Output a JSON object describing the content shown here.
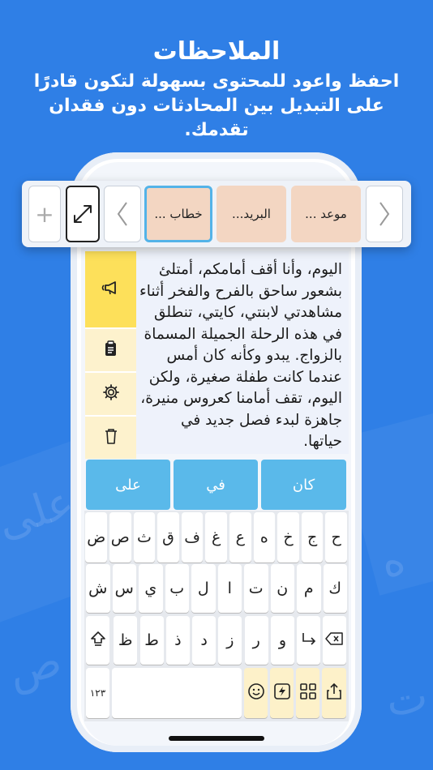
{
  "headline": {
    "title": "الملاحظات",
    "subtitle": "احفظ واعود للمحتوى بسهولة لتكون قادرًا على التبديل بين المحادثات دون فقدان تقدمك."
  },
  "background_letters": [
    "على",
    "ه",
    "ص",
    "ت"
  ],
  "tabbar": {
    "add_label": "+",
    "tabs": [
      {
        "label": "خطاب ...",
        "active": true
      },
      {
        "label": "البريد...",
        "active": false
      },
      {
        "label": "موعد ...",
        "active": false
      }
    ]
  },
  "note": {
    "text": "اليوم، وأنا أقف أمامكم، أمتلئ بشعور ساحق بالفرح والفخر أثناء مشاهدتي لابنتي، كايتي، تنطلق في هذه الرحلة الجميلة المسماة بالزواج. يبدو وكأنه كان أمس عندما كانت طفلة صغيرة، ولكن اليوم، تقف أمامنا كعروس منيرة، جاهزة لبدء فصل جديد في حياتها."
  },
  "side_actions": [
    "speak-icon",
    "paste-icon",
    "settings-icon",
    "delete-icon"
  ],
  "suggestions": [
    "كان",
    "في",
    "على"
  ],
  "keyboard": {
    "row1": [
      "ح",
      "ج",
      "خ",
      "ه",
      "ع",
      "غ",
      "ف",
      "ق",
      "ث",
      "ص",
      "ض"
    ],
    "row2": [
      "ك",
      "م",
      "ن",
      "ت",
      "ا",
      "ل",
      "ب",
      "ي",
      "س",
      "ش"
    ],
    "row3": [
      "و",
      "ر",
      "ز",
      "د",
      "ذ",
      "ط",
      "ظ"
    ],
    "numbers_label": "١٢٣"
  },
  "colors": {
    "background": "#2f7fe6",
    "note_tab": "#f3d6c2",
    "active_tab_border": "#53b3e8",
    "suggestion": "#5ab9ea",
    "side_primary": "#fde05a",
    "side_secondary": "#fdf2cd"
  }
}
